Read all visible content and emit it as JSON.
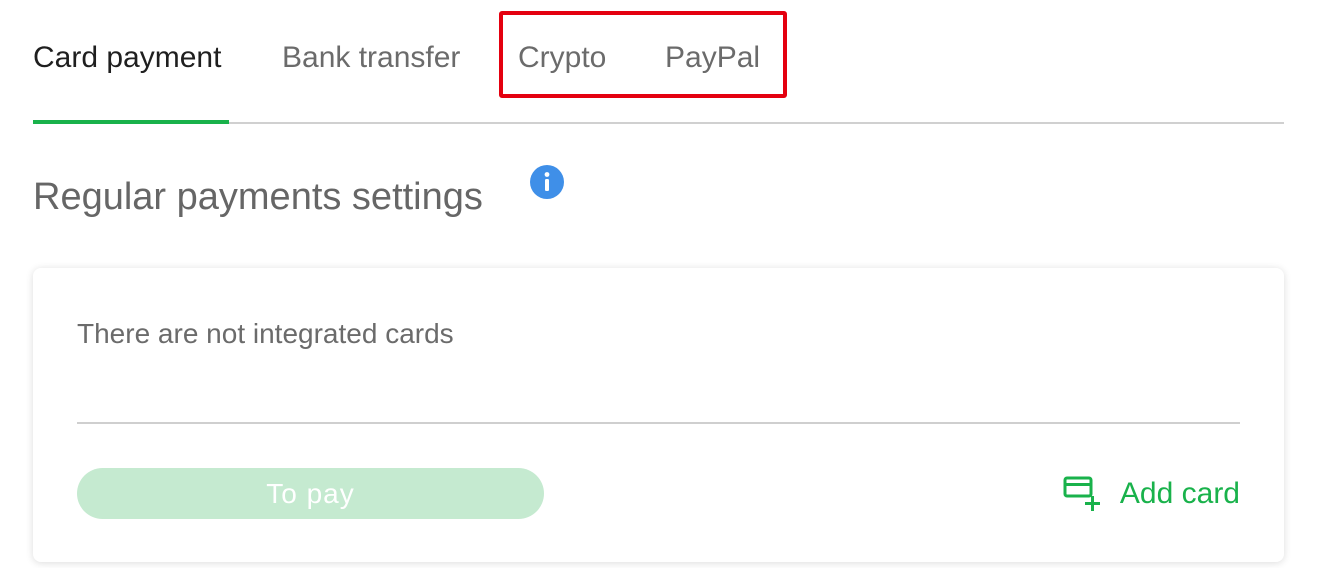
{
  "tabs": [
    {
      "label": "Card payment",
      "active": true
    },
    {
      "label": "Bank transfer",
      "active": false
    },
    {
      "label": "Crypto",
      "active": false
    },
    {
      "label": "PayPal",
      "active": false
    }
  ],
  "section": {
    "title": "Regular payments settings",
    "info_icon": "info-icon"
  },
  "cards_panel": {
    "empty_message": "There are not integrated cards",
    "pay_button_label": "To pay",
    "pay_button_enabled": false,
    "add_card_label": "Add card",
    "add_card_icon": "card-plus-icon"
  },
  "colors": {
    "accent": "#19b24b",
    "pay_button_disabled": "#c5ead0",
    "info_blue": "#3f8fe8",
    "highlight_red": "#e4000f"
  }
}
